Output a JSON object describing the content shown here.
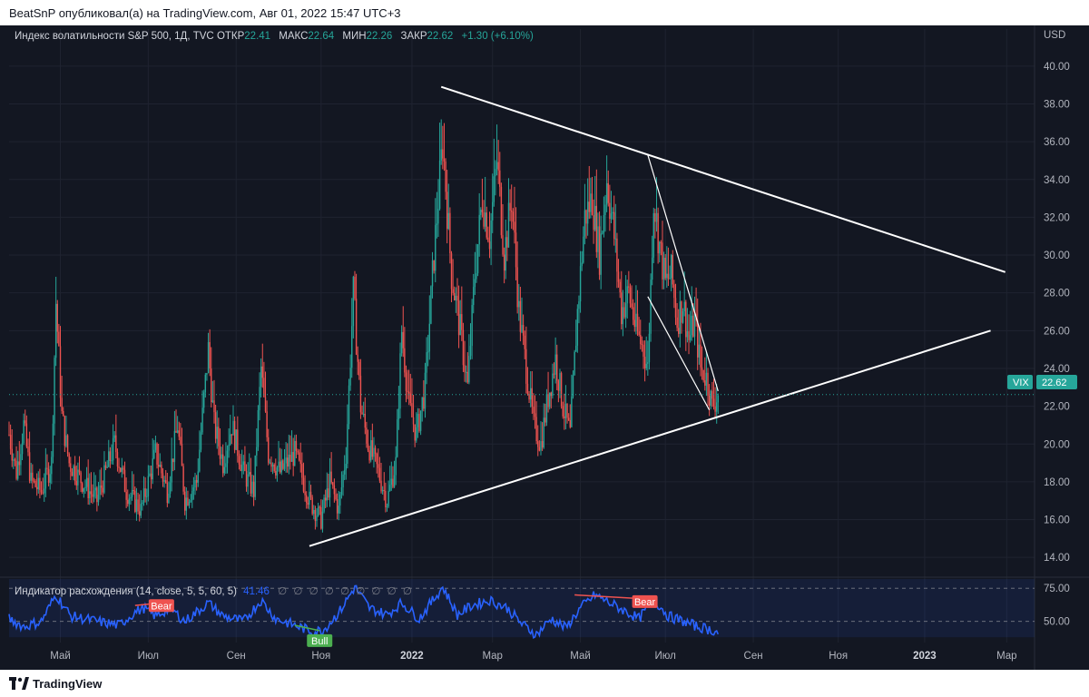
{
  "header": {
    "author_line": "BeatSnP опубликовал(а) на TradingView.com, Авг 01, 2022 15:47 UTC+3"
  },
  "legend": {
    "name": "Индекс волатильности S&P 500, 1Д, TVC",
    "open_label": "ОТКР",
    "open": "22.41",
    "high_label": "МАКС",
    "high": "22.64",
    "low_label": "МИН",
    "low": "22.26",
    "close_label": "ЗАКР",
    "close": "22.62",
    "change": "+1.30 (+6.10%)"
  },
  "indicator": {
    "name": "Индикатор расхождения (14, close, 5, 5, 60, 5)",
    "value": "41.46",
    "nans": "∅ ∅ ∅ ∅ ∅ ∅ ∅ ∅ ∅",
    "bear_label": "Bear",
    "bull_label": "Bull"
  },
  "footer": {
    "brand": "TradingView"
  },
  "colors": {
    "background": "#131722",
    "up": "#26a69a",
    "down": "#ef5350",
    "indicator": "#2962ff",
    "trendline": "#ffffff",
    "grid": "#1f2330"
  },
  "chart_data": {
    "type": "candlestick",
    "currency": "USD",
    "price_tag_label": "VIX",
    "last_price": 22.62,
    "ylim": [
      13,
      41
    ],
    "yticks": [
      14,
      16,
      18,
      20,
      22,
      24,
      26,
      28,
      30,
      32,
      34,
      36,
      38,
      40
    ],
    "xlabels": [
      "Май",
      "Июл",
      "Сен",
      "Ноя",
      "2022",
      "Мар",
      "Май",
      "Июл",
      "Сен",
      "Ноя",
      "2023",
      "Мар"
    ],
    "xlabels_bold": [
      "2022",
      "2023"
    ],
    "key_points": [
      {
        "t": 0,
        "v": 20.5
      },
      {
        "t": 5,
        "v": 18.5
      },
      {
        "t": 10,
        "v": 21
      },
      {
        "t": 15,
        "v": 18
      },
      {
        "t": 22,
        "v": 17.5
      },
      {
        "t": 29,
        "v": 19
      },
      {
        "t": 32,
        "v": 27.5
      },
      {
        "t": 36,
        "v": 21.5
      },
      {
        "t": 41,
        "v": 19
      },
      {
        "t": 50,
        "v": 18
      },
      {
        "t": 60,
        "v": 17
      },
      {
        "t": 72,
        "v": 20
      },
      {
        "t": 80,
        "v": 17.5
      },
      {
        "t": 90,
        "v": 16.5
      },
      {
        "t": 100,
        "v": 19.5
      },
      {
        "t": 108,
        "v": 17.5
      },
      {
        "t": 115,
        "v": 21
      },
      {
        "t": 120,
        "v": 17
      },
      {
        "t": 128,
        "v": 18
      },
      {
        "t": 136,
        "v": 25
      },
      {
        "t": 140,
        "v": 21
      },
      {
        "t": 146,
        "v": 19
      },
      {
        "t": 152,
        "v": 21
      },
      {
        "t": 160,
        "v": 18.5
      },
      {
        "t": 167,
        "v": 17.5
      },
      {
        "t": 172,
        "v": 24
      },
      {
        "t": 177,
        "v": 19.5
      },
      {
        "t": 185,
        "v": 18.5
      },
      {
        "t": 195,
        "v": 19.5
      },
      {
        "t": 205,
        "v": 17
      },
      {
        "t": 213,
        "v": 16
      },
      {
        "t": 219,
        "v": 18
      },
      {
        "t": 225,
        "v": 16.5
      },
      {
        "t": 230,
        "v": 19.5
      },
      {
        "t": 235,
        "v": 28
      },
      {
        "t": 240,
        "v": 22
      },
      {
        "t": 245,
        "v": 20
      },
      {
        "t": 252,
        "v": 18.5
      },
      {
        "t": 258,
        "v": 17
      },
      {
        "t": 264,
        "v": 19
      },
      {
        "t": 268,
        "v": 26
      },
      {
        "t": 273,
        "v": 22
      },
      {
        "t": 278,
        "v": 20.5
      },
      {
        "t": 284,
        "v": 23
      },
      {
        "t": 290,
        "v": 30
      },
      {
        "t": 296,
        "v": 36
      },
      {
        "t": 302,
        "v": 29
      },
      {
        "t": 308,
        "v": 26
      },
      {
        "t": 313,
        "v": 23
      },
      {
        "t": 318,
        "v": 29
      },
      {
        "t": 323,
        "v": 33
      },
      {
        "t": 328,
        "v": 31
      },
      {
        "t": 333,
        "v": 35
      },
      {
        "t": 338,
        "v": 30
      },
      {
        "t": 343,
        "v": 33
      },
      {
        "t": 348,
        "v": 27
      },
      {
        "t": 353,
        "v": 24
      },
      {
        "t": 358,
        "v": 21
      },
      {
        "t": 363,
        "v": 20
      },
      {
        "t": 368,
        "v": 22.5
      },
      {
        "t": 373,
        "v": 24.5
      },
      {
        "t": 378,
        "v": 22
      },
      {
        "t": 383,
        "v": 20.5
      },
      {
        "t": 388,
        "v": 27
      },
      {
        "t": 393,
        "v": 32
      },
      {
        "t": 398,
        "v": 33
      },
      {
        "t": 403,
        "v": 30
      },
      {
        "t": 408,
        "v": 34
      },
      {
        "t": 413,
        "v": 31
      },
      {
        "t": 418,
        "v": 27
      },
      {
        "t": 423,
        "v": 28
      },
      {
        "t": 428,
        "v": 26
      },
      {
        "t": 433,
        "v": 25
      },
      {
        "t": 436,
        "v": 24
      },
      {
        "t": 440,
        "v": 33
      },
      {
        "t": 444,
        "v": 30.5
      },
      {
        "t": 448,
        "v": 28.5
      },
      {
        "t": 452,
        "v": 29
      },
      {
        "t": 456,
        "v": 26.5
      },
      {
        "t": 460,
        "v": 27.5
      },
      {
        "t": 464,
        "v": 25.5
      },
      {
        "t": 468,
        "v": 26.5
      },
      {
        "t": 472,
        "v": 24
      },
      {
        "t": 476,
        "v": 23.5
      },
      {
        "t": 480,
        "v": 22
      },
      {
        "t": 484,
        "v": 22.6
      }
    ],
    "indicator_series": {
      "levels": [
        75,
        50
      ],
      "ylim": [
        34,
        82
      ],
      "key_points": [
        {
          "t": 0,
          "v": 52
        },
        {
          "t": 10,
          "v": 46
        },
        {
          "t": 22,
          "v": 50
        },
        {
          "t": 32,
          "v": 70
        },
        {
          "t": 42,
          "v": 54
        },
        {
          "t": 60,
          "v": 50
        },
        {
          "t": 75,
          "v": 47
        },
        {
          "t": 86,
          "v": 57
        },
        {
          "t": 92,
          "v": 60
        },
        {
          "t": 100,
          "v": 54
        },
        {
          "t": 110,
          "v": 60
        },
        {
          "t": 120,
          "v": 50
        },
        {
          "t": 136,
          "v": 64
        },
        {
          "t": 146,
          "v": 54
        },
        {
          "t": 160,
          "v": 50
        },
        {
          "t": 172,
          "v": 66
        },
        {
          "t": 182,
          "v": 52
        },
        {
          "t": 200,
          "v": 45
        },
        {
          "t": 208,
          "v": 42
        },
        {
          "t": 215,
          "v": 44
        },
        {
          "t": 226,
          "v": 58
        },
        {
          "t": 236,
          "v": 76
        },
        {
          "t": 246,
          "v": 60
        },
        {
          "t": 258,
          "v": 55
        },
        {
          "t": 268,
          "v": 64
        },
        {
          "t": 280,
          "v": 52
        },
        {
          "t": 296,
          "v": 76
        },
        {
          "t": 306,
          "v": 55
        },
        {
          "t": 316,
          "v": 62
        },
        {
          "t": 328,
          "v": 66
        },
        {
          "t": 340,
          "v": 60
        },
        {
          "t": 350,
          "v": 48
        },
        {
          "t": 360,
          "v": 40
        },
        {
          "t": 370,
          "v": 52
        },
        {
          "t": 380,
          "v": 45
        },
        {
          "t": 390,
          "v": 60
        },
        {
          "t": 400,
          "v": 70
        },
        {
          "t": 410,
          "v": 64
        },
        {
          "t": 420,
          "v": 58
        },
        {
          "t": 430,
          "v": 52
        },
        {
          "t": 440,
          "v": 67
        },
        {
          "t": 450,
          "v": 54
        },
        {
          "t": 460,
          "v": 50
        },
        {
          "t": 470,
          "v": 46
        },
        {
          "t": 478,
          "v": 44
        },
        {
          "t": 484,
          "v": 41.5
        }
      ]
    },
    "trendlines": [
      {
        "name": "descending-resistance",
        "from": {
          "t": 295,
          "v": 38.9
        },
        "to": {
          "t": 680,
          "v": 29.1
        }
      },
      {
        "name": "ascending-support",
        "from": {
          "t": 205,
          "v": 14.6
        },
        "to": {
          "t": 670,
          "v": 26.0
        }
      },
      {
        "name": "wedge-upper",
        "from": {
          "t": 436,
          "v": 35.3
        },
        "to": {
          "t": 484,
          "v": 22.8
        }
      },
      {
        "name": "wedge-lower",
        "from": {
          "t": 436,
          "v": 27.8
        },
        "to": {
          "t": 478,
          "v": 21.8
        }
      }
    ],
    "divergences": [
      {
        "kind": "bear",
        "from": {
          "t": 86,
          "v": 62
        },
        "to": {
          "t": 104,
          "v": 64
        }
      },
      {
        "kind": "bear",
        "from": {
          "t": 386,
          "v": 70
        },
        "to": {
          "t": 434,
          "v": 67
        }
      },
      {
        "kind": "bull",
        "from": {
          "t": 195,
          "v": 47
        },
        "to": {
          "t": 212,
          "v": 43
        }
      }
    ],
    "time_axis": {
      "t_range": [
        0,
        700
      ],
      "labels_at": [
        35,
        95,
        155,
        213,
        275,
        330,
        390,
        448,
        508,
        566,
        625,
        681
      ]
    }
  }
}
